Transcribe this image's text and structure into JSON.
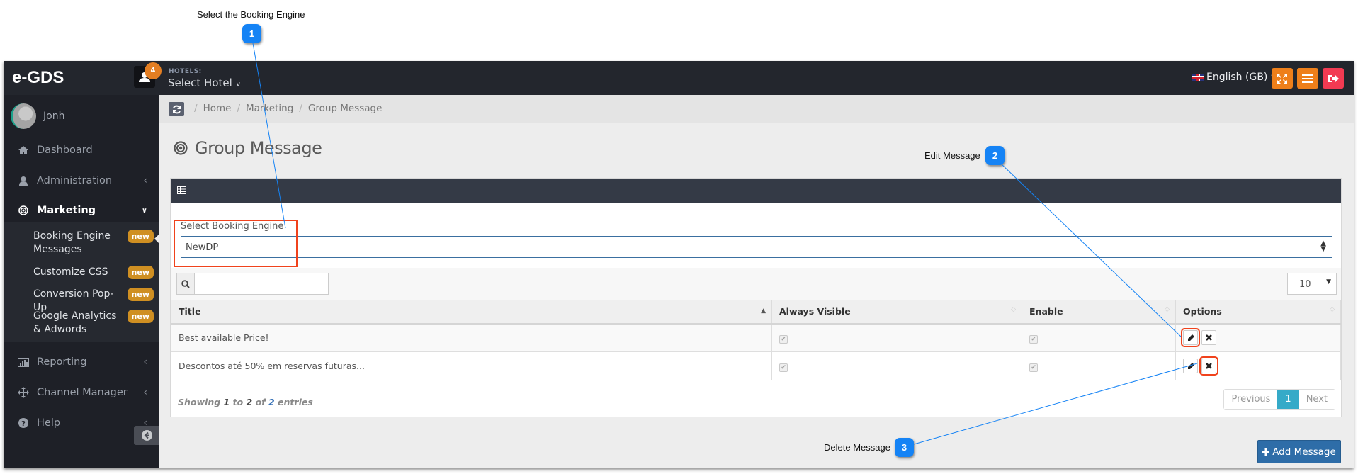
{
  "annotations": [
    {
      "number": "1",
      "label": "Select the Booking Engine"
    },
    {
      "number": "2",
      "label": "Edit Message"
    },
    {
      "number": "3",
      "label": "Delete Message"
    }
  ],
  "topnav": {
    "brand": "e-GDS",
    "notification_count": "4",
    "hotels_label": "HOTELS:",
    "hotel_select": "Select Hotel",
    "language": "English (GB)"
  },
  "sidebar": {
    "user_name": "Jonh",
    "items": [
      {
        "label": "Dashboard",
        "icon": "home-icon"
      },
      {
        "label": "Administration",
        "icon": "user-icon"
      },
      {
        "label": "Marketing",
        "icon": "bullseye-icon",
        "active": true
      },
      {
        "label": "Reporting",
        "icon": "bar-chart-icon"
      },
      {
        "label": "Channel Manager",
        "icon": "arrows-icon"
      },
      {
        "label": "Help",
        "icon": "question-circle-icon"
      }
    ],
    "submenu": [
      {
        "label": "Booking Engine Messages",
        "badge": "new",
        "active": true
      },
      {
        "label": "Customize CSS",
        "badge": "new"
      },
      {
        "label": "Conversion Pop-Up",
        "badge": "new"
      },
      {
        "label": "Google Analytics & Adwords",
        "badge": "new"
      }
    ]
  },
  "breadcrumb": [
    "Home",
    "Marketing",
    "Group Message"
  ],
  "page": {
    "title": "Group Message",
    "booking_engine_label": "Select Booking Engine",
    "booking_engine_value": "NewDP",
    "search_value": "",
    "page_length": "10",
    "table": {
      "columns": [
        "Title",
        "Always Visible",
        "Enable",
        "Options"
      ],
      "rows": [
        {
          "title": "Best available Price!",
          "always_visible": true,
          "enable": true
        },
        {
          "title": "Descontos até 50% em reservas futuras...",
          "always_visible": true,
          "enable": true
        }
      ]
    },
    "info": {
      "prefix": "Showing",
      "from": "1",
      "to_word": "to",
      "to": "2",
      "of_word": "of",
      "total": "2",
      "suffix": "entries"
    },
    "pagination": {
      "previous": "Previous",
      "current": "1",
      "next": "Next"
    },
    "add_button": "Add Message"
  }
}
